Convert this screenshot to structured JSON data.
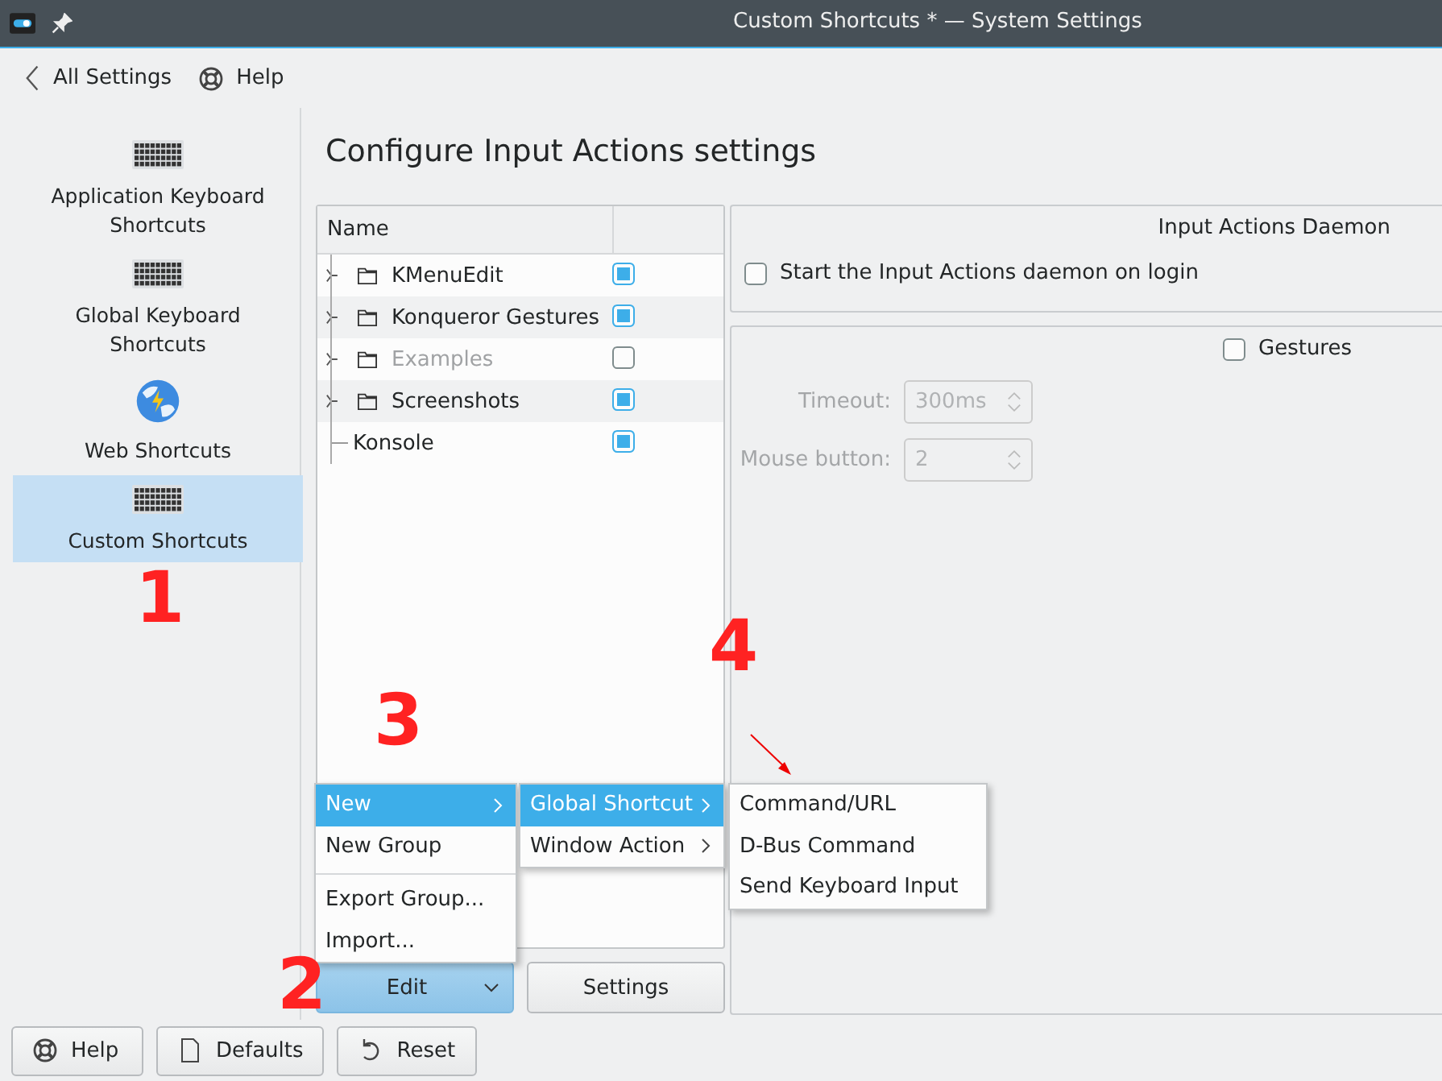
{
  "window": {
    "title": "Custom Shortcuts * — System Settings"
  },
  "toolbar": [
    {
      "label": "All Settings",
      "kind": "back"
    },
    {
      "label": "Help",
      "kind": "help"
    }
  ],
  "sidebar": {
    "items": [
      {
        "label": "Application Keyboard Shortcuts",
        "kind": "keyboard",
        "selected": false
      },
      {
        "label": "Global Keyboard Shortcuts",
        "kind": "keyboard",
        "selected": false
      },
      {
        "label": "Web Shortcuts",
        "kind": "globe",
        "selected": false
      },
      {
        "label": "Custom Shortcuts",
        "kind": "keyboard",
        "selected": true
      }
    ]
  },
  "heading": "Configure Input Actions settings",
  "tree": {
    "columns": [
      "Name"
    ],
    "rows": [
      {
        "label": "KMenuEdit",
        "kind": "group",
        "checked": true,
        "disabled": false
      },
      {
        "label": "Konqueror Gestures",
        "kind": "group",
        "checked": true,
        "disabled": false
      },
      {
        "label": "Examples",
        "kind": "group",
        "checked": false,
        "disabled": true
      },
      {
        "label": "Screenshots",
        "kind": "group",
        "checked": true,
        "disabled": false
      },
      {
        "label": "Konsole",
        "kind": "action",
        "checked": true,
        "disabled": false
      }
    ]
  },
  "tree_buttons": [
    {
      "label": "Edit",
      "kind": "dropdown",
      "selected": true
    },
    {
      "label": "Settings",
      "kind": "plain",
      "selected": false
    }
  ],
  "daemon": {
    "title": "Input Actions Daemon",
    "option": {
      "label": "Start the Input Actions daemon on login",
      "checked": false
    }
  },
  "gestures": {
    "label": "Gestures",
    "checked": false,
    "fields": [
      {
        "label": "Timeout:",
        "value": "300ms",
        "disabled": true
      },
      {
        "label": "Mouse button:",
        "value": "2",
        "disabled": true
      }
    ]
  },
  "menus": [
    {
      "items": [
        {
          "label": "New",
          "submenu": true,
          "selected": true,
          "separator_before": false
        },
        {
          "label": "New Group",
          "submenu": false,
          "selected": false,
          "separator_before": false
        },
        {
          "label": "Export Group...",
          "submenu": false,
          "selected": false,
          "separator_before": true
        },
        {
          "label": "Import...",
          "submenu": false,
          "selected": false,
          "separator_before": false
        }
      ]
    },
    {
      "items": [
        {
          "label": "Global Shortcut",
          "submenu": true,
          "selected": true,
          "separator_before": false
        },
        {
          "label": "Window Action",
          "submenu": true,
          "selected": false,
          "separator_before": false
        }
      ]
    },
    {
      "items": [
        {
          "label": "Command/URL",
          "submenu": false,
          "selected": false,
          "separator_before": false
        },
        {
          "label": "D-Bus Command",
          "submenu": false,
          "selected": false,
          "separator_before": false
        },
        {
          "label": "Send Keyboard Input",
          "submenu": false,
          "selected": false,
          "separator_before": false
        }
      ]
    }
  ],
  "bottom_buttons": [
    {
      "label": "Help",
      "kind": "help"
    },
    {
      "label": "Defaults",
      "kind": "defaults"
    },
    {
      "label": "Reset",
      "kind": "reset"
    }
  ],
  "annotations": [
    {
      "label": "1"
    },
    {
      "label": "2"
    },
    {
      "label": "3"
    },
    {
      "label": "4"
    }
  ]
}
